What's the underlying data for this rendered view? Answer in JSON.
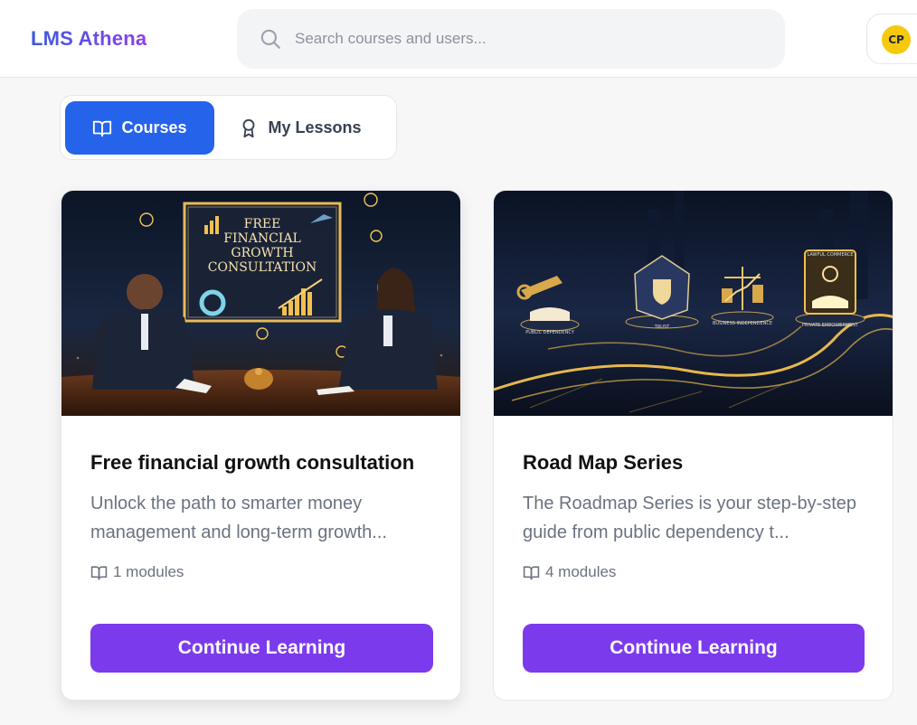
{
  "header": {
    "brand": "LMS Athena",
    "search": {
      "placeholder": "Search courses and users..."
    },
    "user": {
      "initials": "CP"
    }
  },
  "tabs": [
    {
      "label": "Courses",
      "active": true
    },
    {
      "label": "My Lessons",
      "active": false
    }
  ],
  "courses": [
    {
      "title": "Free financial growth consultation",
      "description": "Unlock the path to smarter money management and long-term growth...",
      "modules": "1 modules",
      "cta": "Continue Learning",
      "image": {
        "headline": [
          "FREE",
          "FINANCIAL",
          "GROWTH",
          "CONSULTATION"
        ]
      }
    },
    {
      "title": "Road Map Series",
      "description": "The Roadmap Series is your step-by-step guide from public dependency t...",
      "modules": "4 modules",
      "cta": "Continue Learning",
      "image": {
        "labels": [
          "PUBLIC DEPENDENCY",
          "TRUST",
          "BUSINESS INDEPENDENCE",
          "PRIVATE EMPOWERMENT",
          "LAWFUL COMMERCE"
        ]
      }
    }
  ],
  "colors": {
    "brand_gradient": [
      "#3b5bdb",
      "#8b3fe8"
    ],
    "tab_active": "#2563eb",
    "cta": "#7c3aed",
    "avatar": "#f6c90e"
  }
}
